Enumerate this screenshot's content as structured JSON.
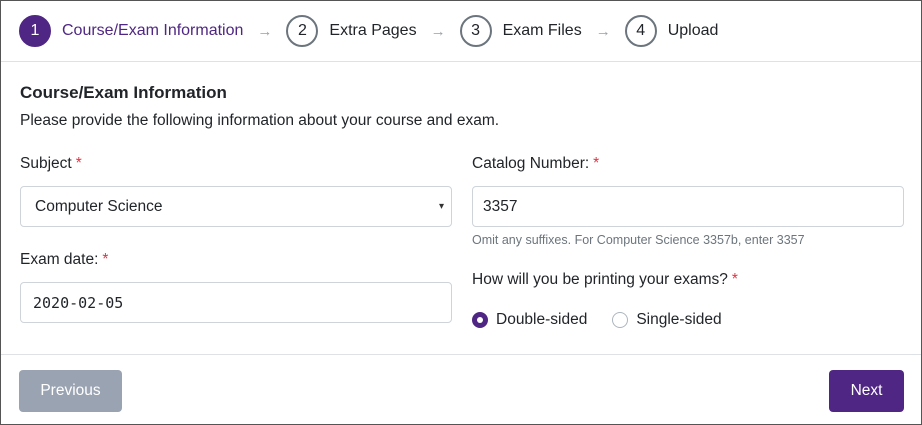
{
  "stepper": {
    "steps": [
      {
        "number": "1",
        "label": "Course/Exam Information"
      },
      {
        "number": "2",
        "label": "Extra Pages"
      },
      {
        "number": "3",
        "label": "Exam Files"
      },
      {
        "number": "4",
        "label": "Upload"
      }
    ],
    "arrow": "→"
  },
  "form": {
    "title": "Course/Exam Information",
    "description": "Please provide the following information about your course and exam.",
    "required_marker": "*",
    "subject": {
      "label": "Subject",
      "value": "Computer Science",
      "caret": "▾"
    },
    "catalog": {
      "label": "Catalog Number:",
      "value": "3357",
      "help": "Omit any suffixes. For Computer Science 3357b, enter 3357"
    },
    "exam_date": {
      "label": "Exam date:",
      "value": "2020-02-05"
    },
    "printing": {
      "label": "How will you be printing your exams?",
      "options": [
        {
          "label": "Double-sided",
          "checked": true
        },
        {
          "label": "Single-sided",
          "checked": false
        }
      ]
    }
  },
  "footer": {
    "previous_label": "Previous",
    "next_label": "Next"
  },
  "colors": {
    "accent": "#4f2683",
    "required": "#dc3545",
    "disabled_button": "#9aa3b2"
  }
}
